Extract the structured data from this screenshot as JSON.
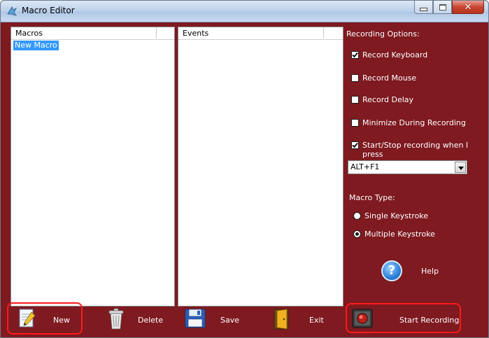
{
  "window": {
    "title": "Macro Editor"
  },
  "macros_list": {
    "header": "Macros",
    "items": [
      "New Macro"
    ]
  },
  "events_list": {
    "header": "Events"
  },
  "recording_options": {
    "heading": "Recording Options:",
    "record_keyboard": {
      "label": "Record Keyboard",
      "checked": true
    },
    "record_mouse": {
      "label": "Record Mouse",
      "checked": false
    },
    "record_delay": {
      "label": "Record Delay",
      "checked": false
    },
    "minimize": {
      "label": "Minimize During Recording",
      "checked": false
    },
    "start_stop": {
      "label": "Start/Stop recording when I press",
      "checked": true
    },
    "hotkey": "ALT+F1"
  },
  "macro_type": {
    "heading": "Macro Type:",
    "single": {
      "label": "Single Keystroke",
      "selected": false
    },
    "multiple": {
      "label": "Multiple Keystroke",
      "selected": true
    }
  },
  "help": {
    "label": "Help"
  },
  "toolbar": {
    "new_label": "New",
    "delete_label": "Delete",
    "save_label": "Save",
    "exit_label": "Exit",
    "start_recording_label": "Start Recording"
  },
  "colors": {
    "background": "#7e1a20",
    "highlight": "#ff1a1a",
    "selection": "#3399ff"
  }
}
